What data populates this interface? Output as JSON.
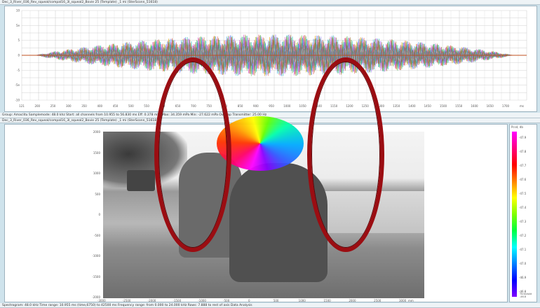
{
  "top_title": "Dec_3_River_036_Rev_squeal/compal16_3l_squeal2_Bovie 25 (Template) _1 mi (SterSconn_51618)",
  "status_mid": "Group: Amaclitu  Samplemode: 48.0 khz   Start: all channels from 10.955 to 56.830 ms   Eff: 0.378 mPa   Max: 34.359 mPa   Min: -27.622 mPa   Overlap   Transmitter: 25.00 Hz",
  "bottom_title": "Dec_3_River_036_Rev_squeal/compal16_3l_squeal2_Bovie 25 (Template) _1 mi (SterSconn_51618)",
  "status_bottom": "Spectrogram: 48.0 kHz   Time range: 10.955 ms (time,6750) to 42500 ms   Frequency range: from 0.000 to 24.000 kHz   Rows: 7.888 to rest of axis  Data Analysis",
  "waveform": {
    "y_ticks": [
      "10",
      "5e",
      "5",
      "0",
      "-5",
      "-5e",
      "-10"
    ],
    "x_ticks": [
      "121",
      "200",
      "250",
      "300",
      "350",
      "400",
      "450",
      "500",
      "550",
      "600",
      "650",
      "700",
      "750",
      "800",
      "850",
      "900",
      "950",
      "1000",
      "1050",
      "1100",
      "1150",
      "1200",
      "1250",
      "1300",
      "1350",
      "1400",
      "1450",
      "1500",
      "1550",
      "1600",
      "1650",
      "1700"
    ],
    "x_unit": "ms"
  },
  "image_plot": {
    "y_ticks": [
      "2000",
      "1500",
      "1000",
      "500",
      "0",
      "-500",
      "-1000",
      "-1500",
      "-2000"
    ],
    "x_ticks": [
      "-3000",
      "-2500",
      "-2000",
      "-1500",
      "-1000",
      "-500",
      "0",
      "500",
      "1000",
      "1500",
      "2000",
      "2500",
      "3000"
    ],
    "x_unit": "mm"
  },
  "colorbar": {
    "title": "Pcsd, db",
    "ticks": [
      "-47.9",
      "-47.8",
      "-47.7",
      "-47.6",
      "-47.5",
      "-47.4",
      "-47.3",
      "-47.2",
      "-47.1",
      "-47.0",
      "-46.9",
      "-46.8"
    ],
    "stops": [
      "#ff00ff",
      "#ff0080",
      "#ff0000",
      "#ff8000",
      "#ffff00",
      "#80ff00",
      "#00ff40",
      "#00ffff",
      "#0080ff",
      "#0000ff",
      "#8000ff"
    ]
  },
  "side_label": "Threshold -46.8"
}
